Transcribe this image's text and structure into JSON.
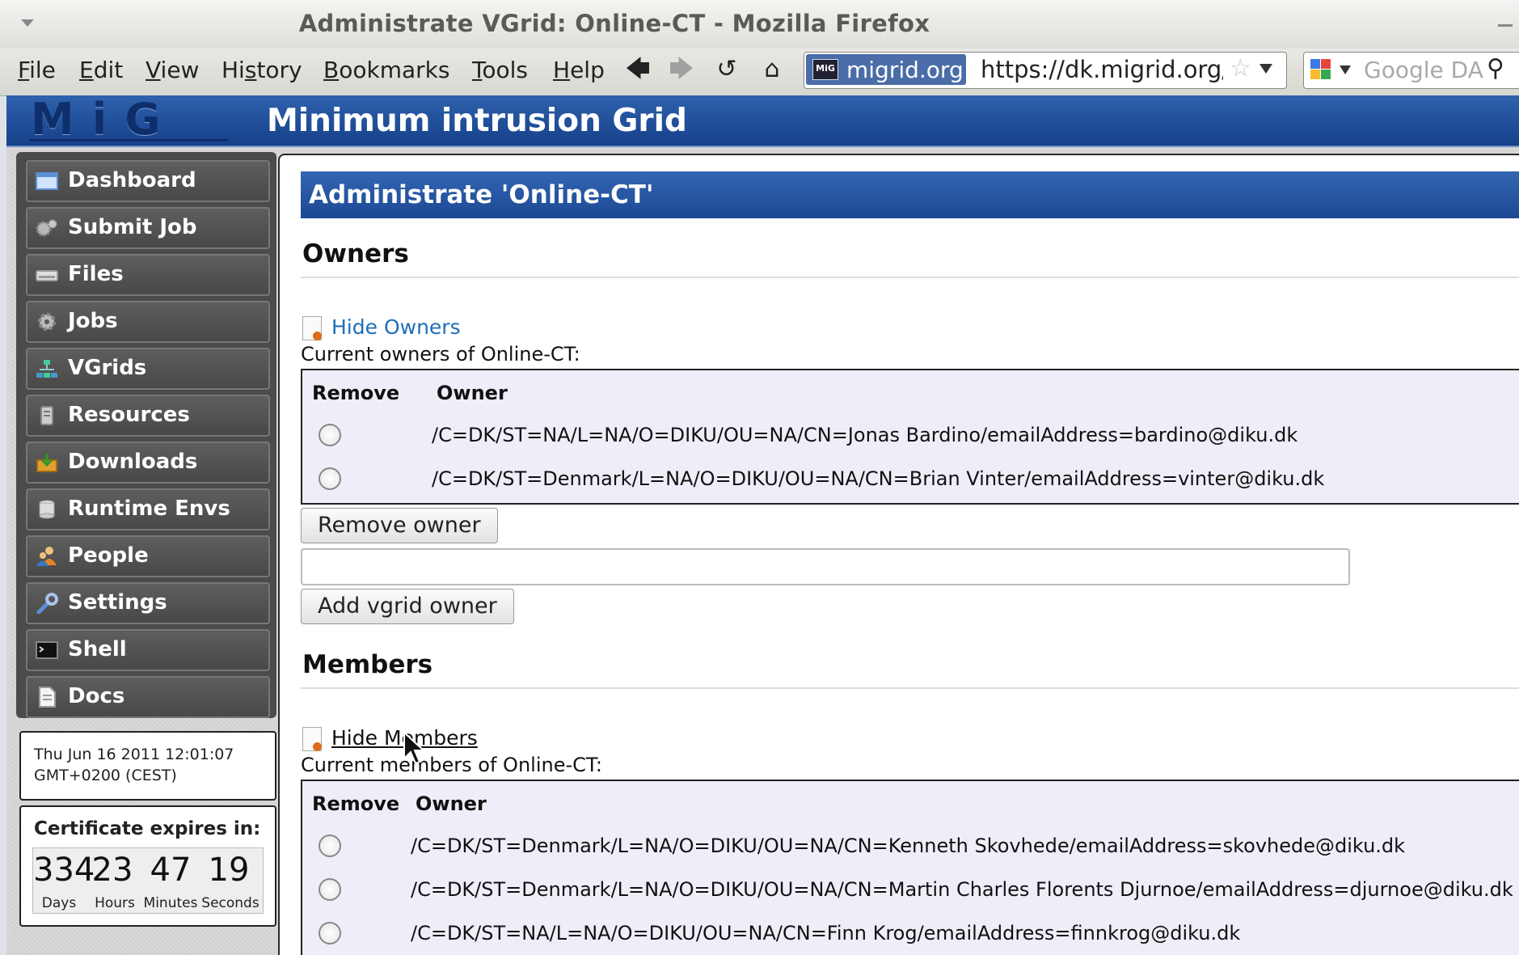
{
  "window": {
    "title": "Administrate VGrid: Online-CT - Mozilla Firefox"
  },
  "menubar": {
    "items": [
      {
        "label": "File",
        "u": "F",
        "rest": "ile"
      },
      {
        "label": "Edit",
        "u": "E",
        "rest": "dit"
      },
      {
        "label": "View",
        "u": "V",
        "rest": "iew"
      },
      {
        "label": "History",
        "pre": "Hi",
        "u": "s",
        "rest": "tory"
      },
      {
        "label": "Bookmarks",
        "u": "B",
        "rest": "ookmarks"
      },
      {
        "label": "Tools",
        "u": "T",
        "rest": "ools"
      },
      {
        "label": "Help",
        "u": "H",
        "rest": "elp"
      }
    ]
  },
  "urlbar": {
    "site_identity": "migrid.org",
    "url": "https://dk.migrid.org/"
  },
  "searchbar": {
    "placeholder": "Google DA"
  },
  "header": {
    "logo_text": "MiG",
    "title": "Minimum intrusion Grid"
  },
  "sidebar": {
    "items": [
      {
        "label": "Dashboard",
        "icon": "dashboard-icon"
      },
      {
        "label": "Submit Job",
        "icon": "gears-icon"
      },
      {
        "label": "Files",
        "icon": "drive-icon"
      },
      {
        "label": "Jobs",
        "icon": "gear-icon"
      },
      {
        "label": "VGrids",
        "icon": "network-icon"
      },
      {
        "label": "Resources",
        "icon": "server-icon"
      },
      {
        "label": "Downloads",
        "icon": "download-icon"
      },
      {
        "label": "Runtime Envs",
        "icon": "cylinder-icon"
      },
      {
        "label": "People",
        "icon": "people-icon"
      },
      {
        "label": "Settings",
        "icon": "wrench-icon"
      },
      {
        "label": "Shell",
        "icon": "terminal-icon"
      },
      {
        "label": "Docs",
        "icon": "document-icon"
      }
    ],
    "clock": {
      "line1": "Thu Jun 16 2011 12:01:07",
      "line2": "GMT+0200 (CEST)"
    },
    "certificate": {
      "title": "Certificate expires in:",
      "days": "334",
      "hours": "23",
      "minutes": "47",
      "seconds": "19",
      "days_label": "Days",
      "hours_label": "Hours",
      "minutes_label": "Minutes",
      "seconds_label": "Seconds"
    }
  },
  "main": {
    "title": "Administrate 'Online-CT'",
    "owners": {
      "heading": "Owners",
      "toggle_link": "Hide Owners",
      "caption": "Current owners of Online-CT:",
      "col_remove": "Remove",
      "col_owner": "Owner",
      "rows": [
        "/C=DK/ST=NA/L=NA/O=DIKU/OU=NA/CN=Jonas Bardino/emailAddress=bardino@diku.dk",
        "/C=DK/ST=Denmark/L=NA/O=DIKU/OU=NA/CN=Brian Vinter/emailAddress=vinter@diku.dk"
      ],
      "remove_button": "Remove owner",
      "add_input_value": "",
      "add_button": "Add vgrid owner"
    },
    "members": {
      "heading": "Members",
      "toggle_link": "Hide Members",
      "caption": "Current members of Online-CT:",
      "col_remove": "Remove",
      "col_owner": "Owner",
      "rows": [
        "/C=DK/ST=Denmark/L=NA/O=DIKU/OU=NA/CN=Kenneth Skovhede/emailAddress=skovhede@diku.dk",
        "/C=DK/ST=Denmark/L=NA/O=DIKU/OU=NA/CN=Martin Charles Florents Djurnoe/emailAddress=djurnoe@diku.dk",
        "/C=DK/ST=NA/L=NA/O=DIKU/OU=NA/CN=Finn Krog/emailAddress=finnkrog@diku.dk"
      ]
    }
  },
  "colors": {
    "header_blue": "#1c4893",
    "link_blue": "#1f6fb8",
    "nav_gray": "#4b4b4b",
    "table_bg": "#eeeef8"
  }
}
